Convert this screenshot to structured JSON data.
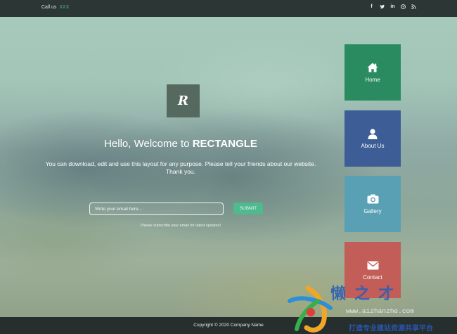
{
  "topbar": {
    "call_label": "Call us",
    "call_value": "XXX",
    "social": [
      {
        "icon": "facebook-icon",
        "glyph": "f"
      },
      {
        "icon": "twitter-icon",
        "glyph": "t"
      },
      {
        "icon": "linkedin-icon",
        "glyph": "in"
      },
      {
        "icon": "pinterest-icon",
        "glyph": "p"
      },
      {
        "icon": "rss-icon",
        "glyph": "r"
      }
    ]
  },
  "hero": {
    "logo_letter": "R",
    "headline_prefix": "Hello, Welcome to",
    "headline_brand": "RECTANGLE",
    "description": "You can download, edit and use this layout for any purpose. Please tell your friends about our website. Thank you.",
    "email_placeholder": "Write your email here...",
    "submit_label": "SUBMIT",
    "note": "Please subscribe your email for latest updates!"
  },
  "menu": {
    "home": {
      "label": "Home",
      "icon": "home-icon",
      "color": "#2a8b61"
    },
    "about": {
      "label": "About Us",
      "icon": "user-icon",
      "color": "#3d5d96"
    },
    "gallery": {
      "label": "Gallery",
      "icon": "camera-icon",
      "color": "#5aa0b5"
    },
    "contact": {
      "label": "Contact",
      "icon": "envelope-icon",
      "color": "#c25d57"
    }
  },
  "footer": {
    "copyright": "Copyright © 2020 Company Name"
  },
  "watermark": {
    "title": "懒之才",
    "url": "www.aizhanzhe.com",
    "subtitle": "打造专业建站资源共享平台"
  }
}
